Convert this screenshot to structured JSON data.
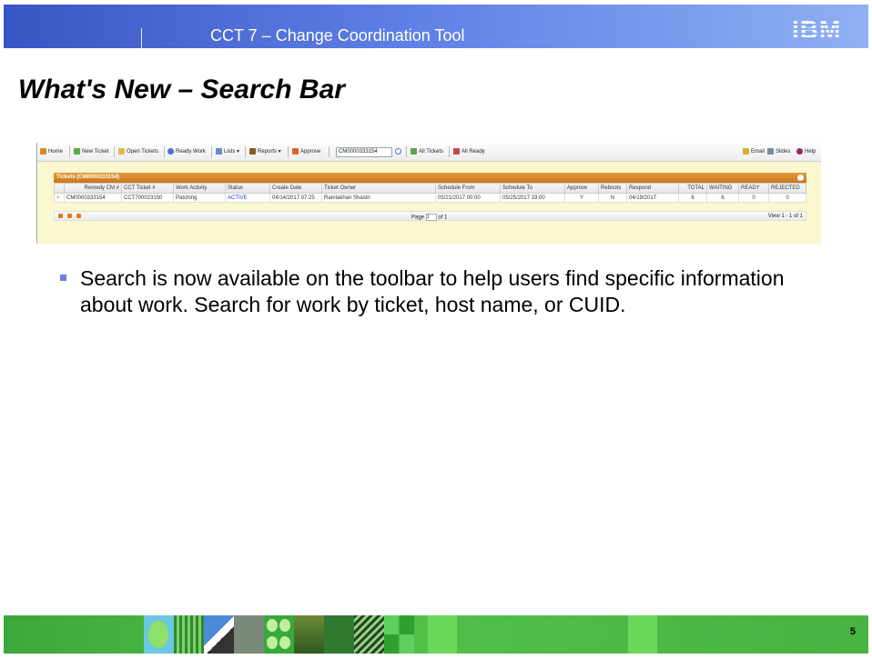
{
  "header": {
    "title": "CCT 7 – Change Coordination Tool",
    "logo": "IBM"
  },
  "slide": {
    "title": "What's New – Search Bar",
    "page_number": "5",
    "bullets": [
      "Search is now available on the toolbar to help users find specific information about work. Search for work by ticket, host name, or CUID."
    ]
  },
  "screenshot": {
    "toolbar": {
      "home": "Home",
      "new_ticket": "New Ticket",
      "open_tickets": "Open Tickets",
      "ready_work": "Ready Work",
      "lists": "Lists ▾",
      "reports": "Reports ▾",
      "approve": "Approve",
      "search_value": "CM0000333154",
      "all_tickets": "All Tickets",
      "all_ready": "All Ready",
      "email": "Email",
      "slides": "Slides",
      "help": "Help"
    },
    "panel": {
      "title": "Tickets (CM0000333154)",
      "columns": [
        "",
        "Remedy CM #",
        "CCT Ticket #",
        "Work Activity",
        "Status",
        "Create Date",
        "Ticket Owner",
        "Schedule From",
        "Schedule To",
        "Approve",
        "Reboots",
        "Respond",
        "TOTAL",
        "WAITING",
        "READY",
        "REJECTED"
      ],
      "rows": [
        [
          "+",
          "CM0000333154",
          "CCT700023150",
          "Patching",
          "ACTIVE",
          "04/14/2017 07:25",
          "Ramlakhan Shastri",
          "05/21/2017 00:00",
          "05/25/2017 19:00",
          "Y",
          "N",
          "04/19/2017",
          "6",
          "6",
          "0",
          "0"
        ]
      ],
      "pager": {
        "page_label": "Page",
        "page_value": "1",
        "of_label": "of 1",
        "view": "View 1 - 1 of 1"
      }
    }
  },
  "colors": {
    "header_start": "#3a55c5",
    "header_end": "#8fb0f3",
    "bullet": "#6a7fe3",
    "footer_green": "#47b341",
    "panel_orange": "#d6842a",
    "status_active": "#2a3fcf"
  }
}
